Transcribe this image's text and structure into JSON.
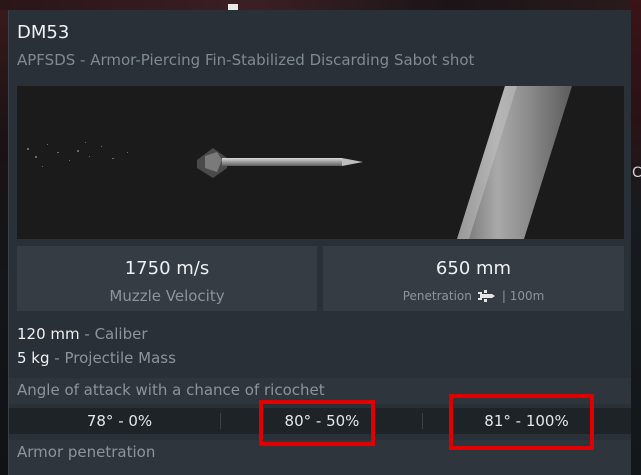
{
  "ammo": {
    "name": "DM53",
    "type": "APFSDS - Armor-Piercing Fin-Stabilized Discarding Sabot shot"
  },
  "stats": {
    "velocity_value": "1750 m/s",
    "velocity_label": "Muzzle Velocity",
    "penetration_value": "650 mm",
    "penetration_label": "Penetration",
    "penetration_range": "| 100m"
  },
  "specs": [
    {
      "value": "120 mm",
      "label": "Caliber"
    },
    {
      "value": "5 kg",
      "label": "Projectile Mass"
    }
  ],
  "ricochet": {
    "heading": "Angle of attack with a chance of ricochet",
    "entries": [
      {
        "angle": "78°",
        "chance": "0%"
      },
      {
        "angle": "80°",
        "chance": "50%"
      },
      {
        "angle": "81°",
        "chance": "100%"
      }
    ]
  },
  "armor": {
    "heading": "Armor penetration"
  },
  "colors": {
    "highlight": "#e00000",
    "panel": "#2a3037",
    "stat_box": "#353c44"
  },
  "icons": [
    "shell-icon"
  ]
}
